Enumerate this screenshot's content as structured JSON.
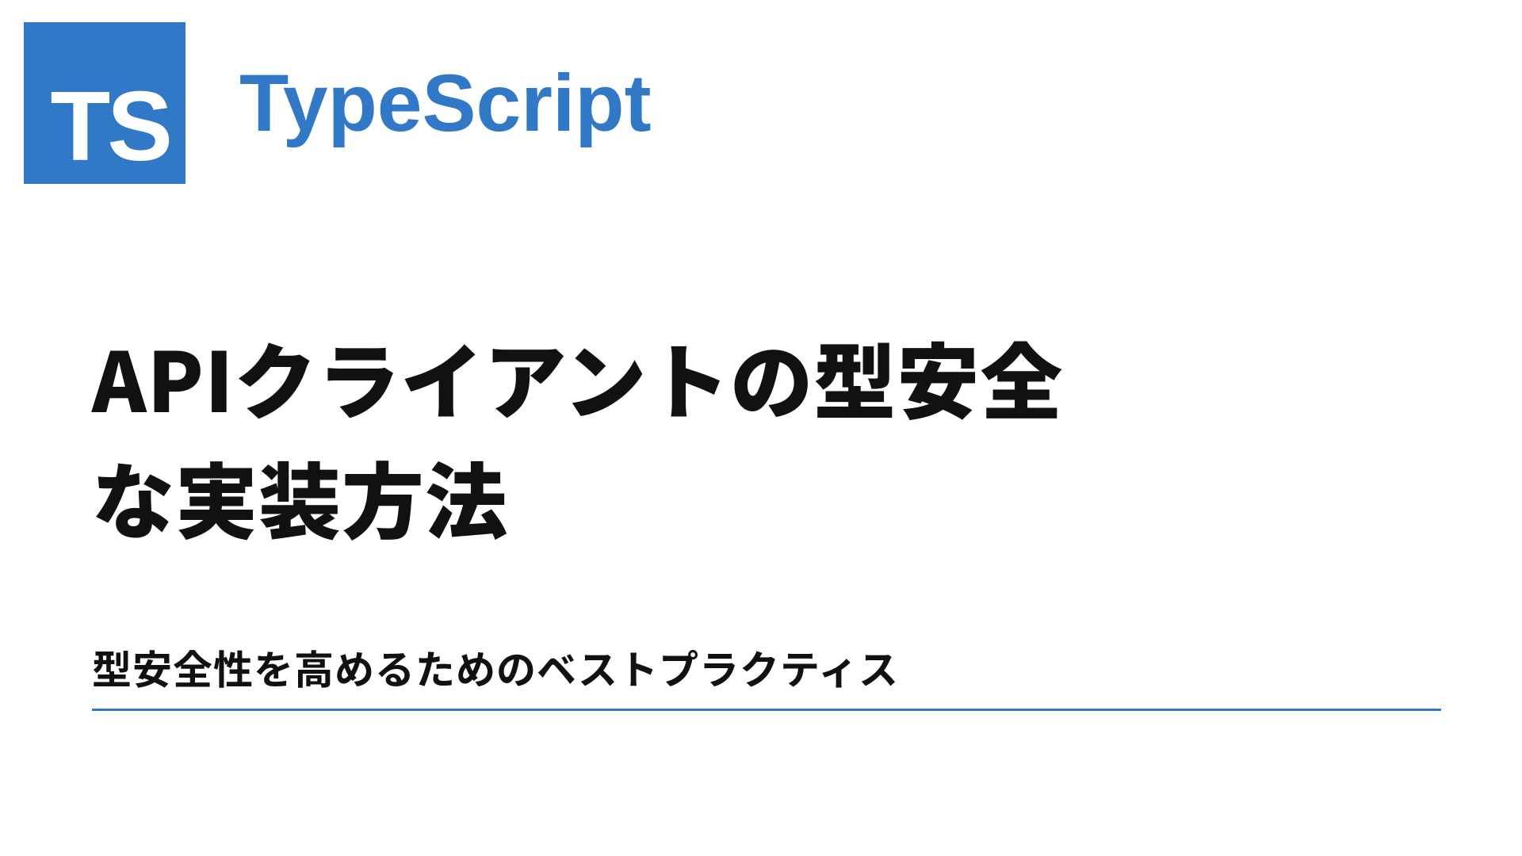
{
  "logo": {
    "badge_text": "TS",
    "label": "TypeScript"
  },
  "title": "APIクライアントの型安全な実装方法",
  "subtitle": "型安全性を高めるためのベストプラクティス",
  "colors": {
    "primary": "#3178c6",
    "ring": "#82aee0"
  }
}
